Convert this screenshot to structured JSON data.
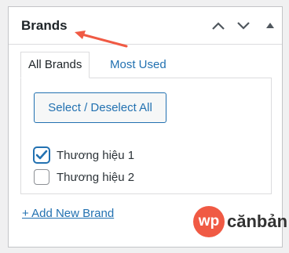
{
  "panel": {
    "title": "Brands"
  },
  "header_controls": [
    {
      "name": "move-up",
      "icon": "chevron-up-icon"
    },
    {
      "name": "move-down",
      "icon": "chevron-down-icon"
    },
    {
      "name": "toggle-panel",
      "icon": "triangle-up-icon"
    }
  ],
  "tabs": [
    {
      "label": "All Brands",
      "active": true
    },
    {
      "label": "Most Used",
      "active": false
    }
  ],
  "select_all_label": "Select / Deselect All",
  "brands": [
    {
      "label": "Thương hiệu 1",
      "checked": true
    },
    {
      "label": "Thương hiệu 2",
      "checked": false
    }
  ],
  "add_new_link": "+ Add New Brand",
  "watermark": {
    "badge_text": "wp",
    "text": "cănbản"
  },
  "colors": {
    "accent": "#2271b1",
    "annotation_arrow": "#f05a44",
    "logo_badge": "#f05a44",
    "border": "#c3c4c7"
  }
}
